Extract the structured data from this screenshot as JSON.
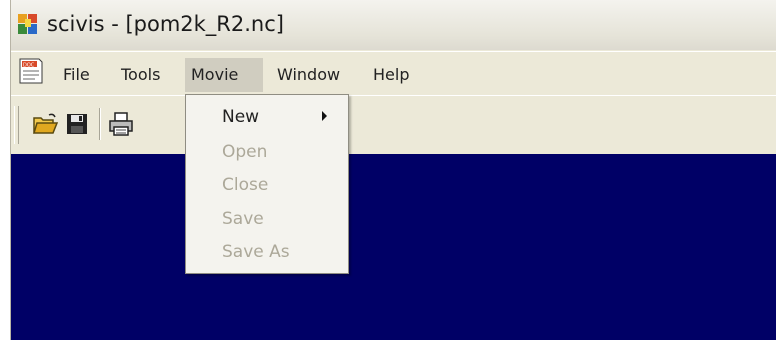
{
  "window": {
    "title": "scivis - [pom2k_R2.nc]",
    "app_icon": "scivis-app-icon",
    "doc_icon": "document-icon"
  },
  "menubar": {
    "items": [
      {
        "label": "File"
      },
      {
        "label": "Tools"
      },
      {
        "label": "Movie"
      },
      {
        "label": "Window"
      },
      {
        "label": "Help"
      }
    ],
    "active": "Movie"
  },
  "toolbar": {
    "buttons": [
      {
        "icon": "open-folder-icon"
      },
      {
        "icon": "save-disk-icon"
      },
      {
        "icon": "printer-icon"
      }
    ]
  },
  "movie_menu": {
    "items": [
      {
        "label": "New",
        "enabled": true,
        "submenu": true
      },
      {
        "label": "Open",
        "enabled": false
      },
      {
        "label": "Close",
        "enabled": false
      },
      {
        "label": "Save",
        "enabled": false
      },
      {
        "label": "Save As",
        "enabled": false
      }
    ]
  },
  "colors": {
    "canvas_background": "#000066",
    "chrome": "#ece9d8"
  }
}
